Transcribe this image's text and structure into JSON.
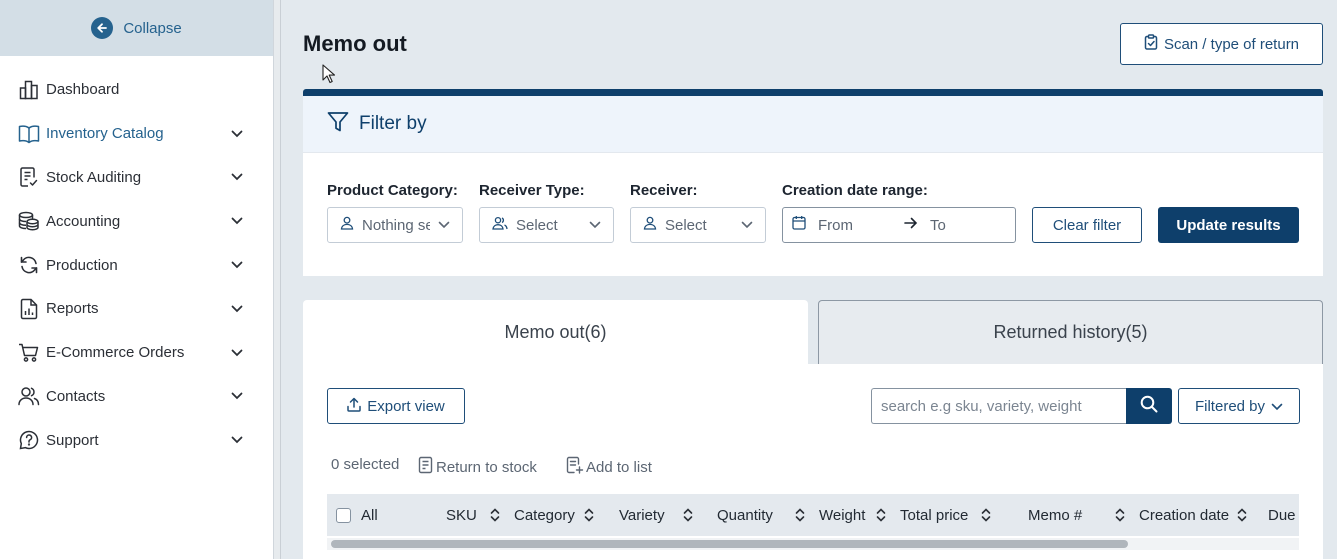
{
  "sidebar": {
    "collapse_label": "Collapse",
    "items": [
      {
        "label": "Dashboard",
        "icon": "dashboard-icon",
        "has_submenu": false,
        "active": false
      },
      {
        "label": "Inventory Catalog",
        "icon": "book-icon",
        "has_submenu": true,
        "active": true
      },
      {
        "label": "Stock Auditing",
        "icon": "clipboard-check-icon",
        "has_submenu": true,
        "active": false
      },
      {
        "label": "Accounting",
        "icon": "coins-icon",
        "has_submenu": true,
        "active": false
      },
      {
        "label": "Production",
        "icon": "refresh-icon",
        "has_submenu": true,
        "active": false
      },
      {
        "label": "Reports",
        "icon": "report-icon",
        "has_submenu": true,
        "active": false
      },
      {
        "label": "E-Commerce Orders",
        "icon": "cart-icon",
        "has_submenu": true,
        "active": false
      },
      {
        "label": "Contacts",
        "icon": "users-icon",
        "has_submenu": true,
        "active": false
      },
      {
        "label": "Support",
        "icon": "help-icon",
        "has_submenu": true,
        "active": false
      }
    ]
  },
  "page": {
    "title": "Memo out",
    "scan_button": "Scan / type of return"
  },
  "filter": {
    "title": "Filter by",
    "product_category": {
      "label": "Product Category:",
      "value": "Nothing selected"
    },
    "receiver_type": {
      "label": "Receiver Type:",
      "value": "Select"
    },
    "receiver": {
      "label": "Receiver:",
      "value": "Select"
    },
    "date_range": {
      "label": "Creation date range:",
      "from": "From",
      "to": "To"
    },
    "clear_button": "Clear filter",
    "update_button": "Update results"
  },
  "tabs": [
    {
      "label": "Memo out(6)",
      "active": true
    },
    {
      "label": "Returned history(5)",
      "active": false
    }
  ],
  "toolbar": {
    "export_button": "Export view",
    "search_placeholder": "search e.g sku, variety, weight",
    "filtered_button": "Filtered by",
    "selected_count": "0 selected",
    "return_to_stock": "Return to stock",
    "add_to_list": "Add to list"
  },
  "table": {
    "columns": [
      "All",
      "SKU",
      "Category",
      "Variety",
      "Quantity",
      "Weight",
      "Total price",
      "Memo #",
      "Creation date",
      "Due"
    ]
  },
  "colors": {
    "primary": "#0e3f6b",
    "accent": "#25628e",
    "background": "#e3e9ee"
  }
}
